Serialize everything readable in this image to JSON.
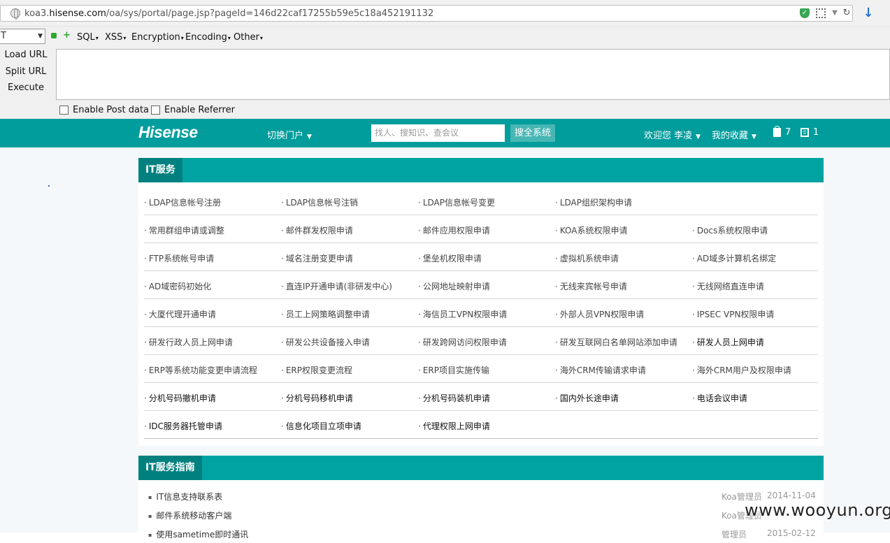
{
  "browser": {
    "url_prefix": "koa3.",
    "url_domain": "hisense.com",
    "url_path": "/oa/sys/portal/page.jsp?pageId=146d22caf17255b59e5c18a452191132"
  },
  "hackbar": {
    "select_value": "T",
    "menus": [
      "SQL",
      "XSS",
      "Encryption",
      "Encoding",
      "Other"
    ],
    "actions": [
      "Load URL",
      "Split URL",
      "Execute"
    ],
    "enable_post": "Enable Post data",
    "enable_referrer": "Enable Referrer"
  },
  "header": {
    "logo": "Hisense",
    "portal_switch": "切换门户",
    "search_placeholder": "找人、搜知识、查会议",
    "search_button": "搜全系统",
    "welcome": "欢迎您 李凌",
    "favorites": "我的收藏",
    "bag_count": "7",
    "doc_count": "1"
  },
  "it_services": {
    "title": "IT服务",
    "rows": [
      [
        "LDAP信息帐号注册",
        "LDAP信息帐号注销",
        "LDAP信息帐号变更",
        "LDAP组织架构申请",
        ""
      ],
      [
        "常用群组申请或调整",
        "邮件群发权限申请",
        "邮件应用权限申请",
        "KOA系统权限申请",
        "Docs系统权限申请"
      ],
      [
        "FTP系统帐号申请",
        "域名注册变更申请",
        "堡垒机权限申请",
        "虚拟机系统申请",
        "AD域多计算机名绑定"
      ],
      [
        "AD域密码初始化",
        "直连IP开通申请(非研发中心)",
        "公网地址映射申请",
        "无线来宾帐号申请",
        "无线网络直连申请"
      ],
      [
        "大厦代理开通申请",
        "员工上网策略调整申请",
        "海信员工VPN权限申请",
        "外部人员VPN权限申请",
        "IPSEC VPN权限申请"
      ],
      [
        "研发行政人员上网申请",
        "研发公共设备接入申请",
        "研发跨网访问权限申请",
        "研发互联网白名单网站添加申请",
        "研发人员上网申请"
      ],
      [
        "ERP等系统功能变更申请流程",
        "ERP权限变更流程",
        "ERP项目实施传输",
        "海外CRM传输请求申请",
        "海外CRM用户及权限申请"
      ],
      [
        "分机号码撤机申请",
        "分机号码移机申请",
        "分机号码装机申请",
        "国内外长途申请",
        "电话会议申请"
      ],
      [
        "IDC服务器托管申请",
        "信息化项目立项申请",
        "代理权限上网申请",
        "",
        ""
      ]
    ]
  },
  "it_guide": {
    "title": "IT服务指南",
    "items": [
      {
        "title": "IT信息支持联系表",
        "author": "Koa管理员",
        "date": "2014-11-04"
      },
      {
        "title": "邮件系统移动客户端",
        "author": "Koa管理员",
        "date": ""
      },
      {
        "title": "使用sametime即时通讯",
        "author": "管理员",
        "date": "2015-02-12"
      }
    ]
  },
  "watermark": "www.wooyun.org"
}
